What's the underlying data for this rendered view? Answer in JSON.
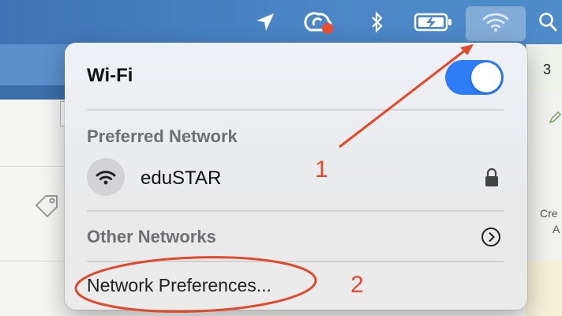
{
  "menubar": {
    "icons": [
      "location-arrow-icon",
      "creative-cloud-icon",
      "bluetooth-icon",
      "battery-charging-icon",
      "wifi-icon",
      "search-icon"
    ]
  },
  "background_app": {
    "right_header_text": "3",
    "right_text_1": "Cre",
    "right_text_2": "A"
  },
  "wifi_menu": {
    "title": "Wi-Fi",
    "toggle_on": true,
    "preferred_heading": "Preferred Network",
    "preferred_networks": [
      {
        "name": "eduSTAR",
        "locked": true
      }
    ],
    "other_heading": "Other Networks",
    "network_prefs_label": "Network Preferences..."
  },
  "annotations": {
    "label_1": "1",
    "label_2": "2",
    "color": "#e24a2c"
  },
  "colors": {
    "menubar": "#4a84c4",
    "toggle_blue": "#2e7cf6"
  }
}
